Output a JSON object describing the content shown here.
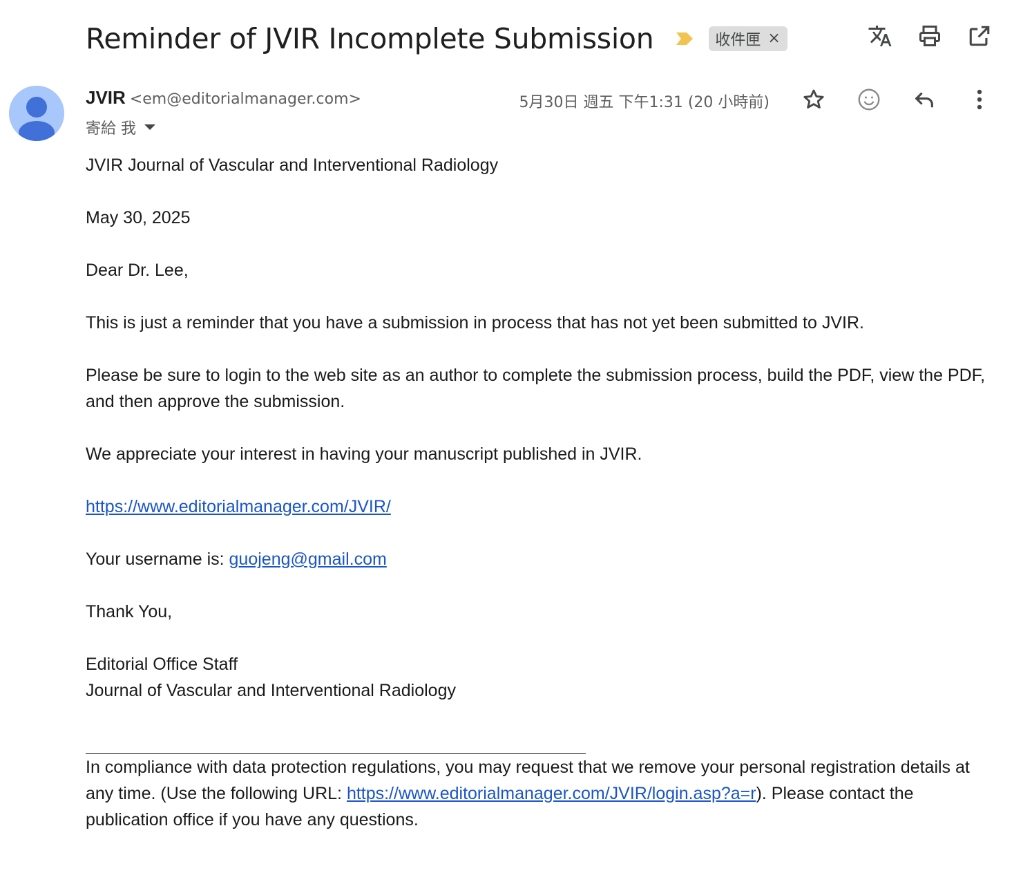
{
  "subject": "Reminder of JVIR Incomplete Submission",
  "label_chip": {
    "text": "收件匣",
    "close": "×"
  },
  "top_actions": [
    "translate-icon",
    "print-icon",
    "open-in-new-window-icon"
  ],
  "sender": {
    "name": "JVIR",
    "email": "<em@editorialmanager.com>",
    "to": "寄給 我",
    "date": "5月30日 週五 下午1:31 (20 小時前)"
  },
  "message_actions": [
    "star-icon",
    "emoji-reaction-icon",
    "reply-icon",
    "more-vert-icon"
  ],
  "colors": {
    "importance_marker": "#f2c34e",
    "avatar_bg": "#a8c7fa",
    "avatar_fg": "#4170d8",
    "link": "#1a55c8"
  },
  "body": {
    "journal_line": "JVIR Journal of Vascular and Interventional Radiology",
    "date": "May 30, 2025",
    "greeting": "Dear Dr. Lee,",
    "para1": "This is just a reminder that you have a submission in process that has not yet been submitted to JVIR.",
    "para2": "Please be sure to login to the web site as an author to complete the submission process, build the PDF, view the PDF, and then approve the submission.",
    "para3": "We appreciate your interest in having your manuscript published in JVIR.",
    "site_link": "https://www.editorialmanager.com/JVIR/",
    "username_label": "Your username is: ",
    "username_link": "guojeng@gmail.com",
    "thanks": "Thank You,",
    "signature_line1": "Editorial Office Staff",
    "signature_line2": "Journal of Vascular and Interventional Radiology",
    "footer_pre": "In compliance with data protection regulations, you may request that we remove your personal registration details at any time.  (Use the following URL: ",
    "footer_link": "https://www.editorialmanager.com/JVIR/login.asp?a=r",
    "footer_post": "). Please contact the publication office if you have any questions."
  }
}
